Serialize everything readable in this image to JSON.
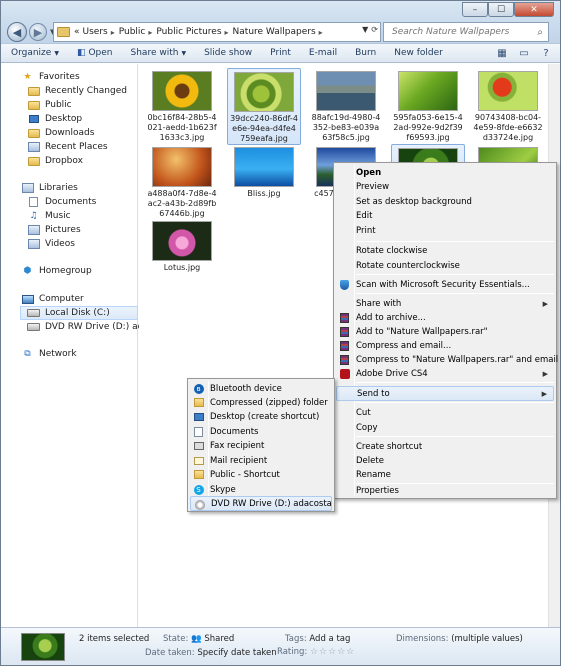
{
  "window": {
    "controls": {
      "minimize": "–",
      "maximize": "☐",
      "close": "✕"
    }
  },
  "address": {
    "prefix": "«",
    "crumbs": [
      "Users",
      "Public",
      "Public Pictures",
      "Nature Wallpapers"
    ],
    "separator": "▸",
    "search_placeholder": "Search Nature Wallpapers"
  },
  "toolbar": {
    "organize": "Organize",
    "open": "Open",
    "share_with": "Share with",
    "slide_show": "Slide show",
    "print": "Print",
    "email": "E-mail",
    "burn": "Burn",
    "new_folder": "New folder"
  },
  "nav": {
    "favorites": "Favorites",
    "recently_changed": "Recently Changed",
    "public": "Public",
    "desktop": "Desktop",
    "downloads": "Downloads",
    "recent_places": "Recent Places",
    "dropbox": "Dropbox",
    "libraries": "Libraries",
    "documents": "Documents",
    "music": "Music",
    "pictures": "Pictures",
    "videos": "Videos",
    "homegroup": "Homegroup",
    "computer": "Computer",
    "local_disk": "Local Disk (C:)",
    "dvd_drive": "DVD RW Drive (D:) adacosta",
    "network": "Network"
  },
  "files": [
    {
      "name": "0bc16f84-28b5-4021-aedd-1b623f1633c3.jpg",
      "selected": false
    },
    {
      "name": "39dcc240-86df-4e6e-94ea-d4fe4759eafa.jpg",
      "selected": true
    },
    {
      "name": "88afc19d-4980-4352-be83-e039a63f58c5.jpg",
      "selected": false
    },
    {
      "name": "595fa053-6e15-42ad-992e-9d2f39f69593.jpg",
      "selected": false
    },
    {
      "name": "90743408-bc04-4e59-8fde-e6632d33724e.jpg",
      "selected": false
    },
    {
      "name": "a488a0f4-7d8e-4ac2-a43b-2d89fb67446b.jpg",
      "selected": false
    },
    {
      "name": "Bliss.jpg",
      "selected": false
    },
    {
      "name": "c4571…b9-a2…",
      "selected": false
    },
    {
      "name": "Lotus.jpg",
      "selected": false
    }
  ],
  "context_menu": {
    "open": "Open",
    "preview": "Preview",
    "set_desktop_bg": "Set as desktop background",
    "edit": "Edit",
    "print": "Print",
    "rotate_cw": "Rotate clockwise",
    "rotate_ccw": "Rotate counterclockwise",
    "scan": "Scan with Microsoft Security Essentials...",
    "share_with": "Share with",
    "add_archive": "Add to archive...",
    "add_rar": "Add to \"Nature Wallpapers.rar\"",
    "compress_email": "Compress and email...",
    "compress_rar_email": "Compress to \"Nature Wallpapers.rar\" and email",
    "adobe_drive": "Adobe Drive CS4",
    "send_to": "Send to",
    "cut": "Cut",
    "copy": "Copy",
    "create_shortcut": "Create shortcut",
    "delete": "Delete",
    "rename": "Rename",
    "properties": "Properties"
  },
  "send_to_menu": {
    "bluetooth": "Bluetooth device",
    "compressed": "Compressed (zipped) folder",
    "desktop": "Desktop (create shortcut)",
    "documents": "Documents",
    "fax": "Fax recipient",
    "mail": "Mail recipient",
    "public_shortcut": "Public - Shortcut",
    "skype": "Skype",
    "dvd": "DVD RW Drive (D:) adacosta"
  },
  "details": {
    "items_selected": "2 items selected",
    "state_key": "State:",
    "state_val": "Shared",
    "date_key": "Date taken:",
    "date_val": "Specify date taken",
    "tags_key": "Tags:",
    "tags_val": "Add a tag",
    "rating_key": "Rating:",
    "rating_stars": "☆☆☆☆☆",
    "dimensions_key": "Dimensions:",
    "dimensions_val": "(multiple values)"
  },
  "colors": {
    "chrome": "#c9dbec",
    "selection": "#d5e6f9",
    "menu_bg": "#f0f0f0"
  }
}
